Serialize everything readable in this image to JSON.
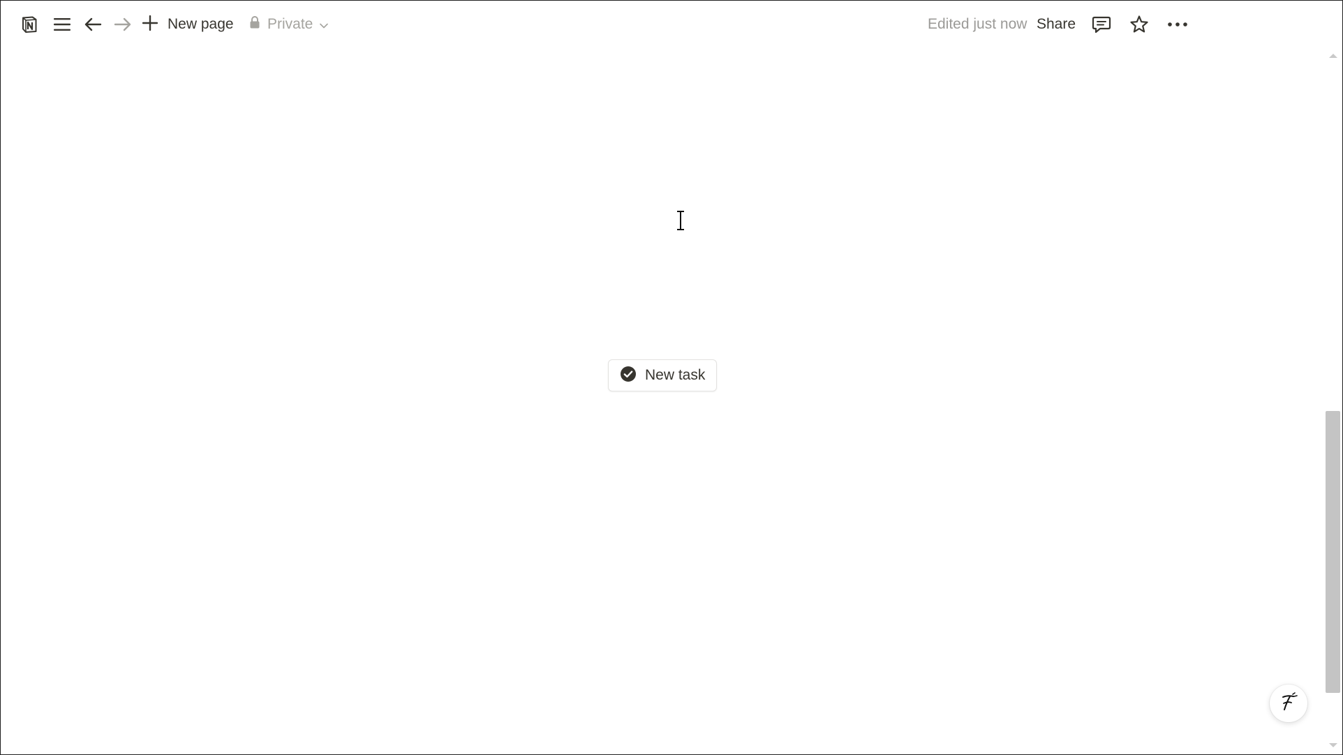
{
  "toolbar": {
    "new_page_label": "New page",
    "privacy_label": "Private",
    "edited_status": "Edited just now",
    "share_label": "Share",
    "icons": {
      "logo": "notion-logo-icon",
      "menu": "hamburger-menu-icon",
      "back": "arrow-left-icon",
      "forward": "arrow-right-icon",
      "add": "plus-icon",
      "lock": "lock-icon",
      "chevron": "chevron-down-icon",
      "comments": "comment-icon",
      "favorite": "star-icon",
      "more": "ellipsis-icon"
    }
  },
  "content": {
    "task_button_label": "New task",
    "task_button_icon": "check-circle-icon"
  },
  "help": {
    "icon": "help-assistant-icon"
  },
  "colors": {
    "text_primary": "#37352f",
    "text_muted": "#9b9a97",
    "scrollbar_thumb": "#c4c4c4"
  }
}
